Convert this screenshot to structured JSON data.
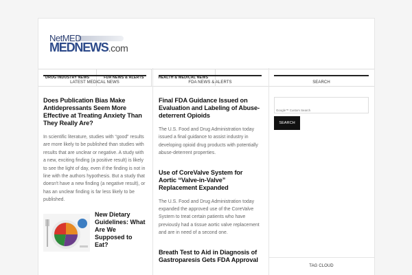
{
  "logo": {
    "line1": "NetMED",
    "line2": "MEDNEWS",
    "line2_suffix": ".com"
  },
  "nav": {
    "items": [
      {
        "label": "DRUG INDUSTRY NEWS"
      },
      {
        "label": "FDA NEWS & ALERTS"
      },
      {
        "label": "HEALTH & MEDICAL NEWS"
      }
    ]
  },
  "latest": {
    "heading": "LATEST MEDICAL NEWS",
    "posts": [
      {
        "title": "Does Publication Bias Make Antidepressants Seem More Effective at Treating Anxiety Than They Really Are?",
        "excerpt": "In scientific literature, studies with “good” results are more likely to be published than studies with results that are unclear or negative. A study with a new, exciting finding (a positive result) is likely to see the light of day, even if the finding is not in line with the authors hypothesis. But a study that doesn't have a new finding (a negative result), or has an unclear finding is far less likely to be published."
      },
      {
        "title": "New Dietary Guidelines: What Are We Supposed to Eat?"
      }
    ]
  },
  "fda": {
    "heading": "FDA NEWS & ALERTS",
    "posts": [
      {
        "title": "Final FDA Guidance Issued on Evaluation and Labeling of Abuse-deterrent Opioids",
        "excerpt": "The U.S. Food and Drug Administration today issued a final guidance to assist industry in developing opioid drug products with potentially abuse-deterrent properties."
      },
      {
        "title": "Use of CoreValve System for Aortic “Valve-in-Valve” Replacement Expanded",
        "excerpt": "The U.S. Food and Drug Administration today expanded the approved use of the CoreValve System to treat certain patients who have previously had a tissue aortic valve replacement and are in need of a second one."
      },
      {
        "title": "Breath Test to Aid in Diagnosis of Gastroparesis Gets FDA Approval"
      }
    ]
  },
  "search": {
    "heading": "SEARCH",
    "placeholder": "Google™ Custom Search",
    "button_label": "SEARCH"
  },
  "tagcloud": {
    "heading": "TAG CLOUD"
  },
  "colors": {
    "brand_blue": "#2d4a8a",
    "text_dark": "#111111",
    "excerpt_gray": "#666666",
    "button_black": "#111111"
  }
}
